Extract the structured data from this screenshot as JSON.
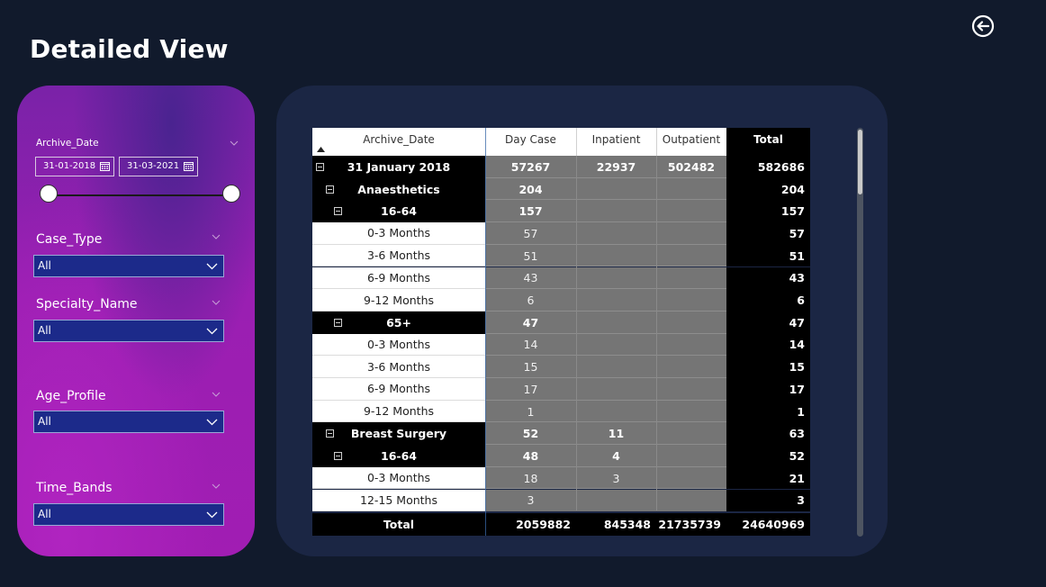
{
  "page": {
    "title": "Detailed View"
  },
  "filters": {
    "archive_date": {
      "label": "Archive_Date",
      "start": "31-01-2018",
      "end": "31-03-2021",
      "range_fraction": [
        0,
        1
      ]
    },
    "case_type": {
      "label": "Case_Type",
      "value": "All"
    },
    "specialty_name": {
      "label": "Specialty_Name",
      "value": "All"
    },
    "age_profile": {
      "label": "Age_Profile",
      "value": "All"
    },
    "time_bands": {
      "label": "Time_Bands",
      "value": "All"
    }
  },
  "matrix": {
    "headers": {
      "archive_date": "Archive_Date",
      "day_case": "Day Case",
      "inpatient": "Inpatient",
      "outpatient": "Outpatient",
      "total": "Total"
    },
    "rows": [
      {
        "kind": "date",
        "label": "31 January 2018",
        "day_case": "57267",
        "inpatient": "22937",
        "outpatient": "502482",
        "total": "582686"
      },
      {
        "kind": "specialty",
        "label": "Anaesthetics",
        "day_case": "204",
        "inpatient": "",
        "outpatient": "",
        "total": "204"
      },
      {
        "kind": "age",
        "label": "16-64",
        "day_case": "157",
        "inpatient": "",
        "outpatient": "",
        "total": "157"
      },
      {
        "kind": "band",
        "label": "0-3 Months",
        "day_case": "57",
        "inpatient": "",
        "outpatient": "",
        "total": "57"
      },
      {
        "kind": "band",
        "label": "3-6 Months",
        "day_case": "51",
        "inpatient": "",
        "outpatient": "",
        "total": "51"
      },
      {
        "kind": "band",
        "label": "6-9 Months",
        "day_case": "43",
        "inpatient": "",
        "outpatient": "",
        "total": "43"
      },
      {
        "kind": "band",
        "label": "9-12 Months",
        "day_case": "6",
        "inpatient": "",
        "outpatient": "",
        "total": "6"
      },
      {
        "kind": "age",
        "label": "65+",
        "day_case": "47",
        "inpatient": "",
        "outpatient": "",
        "total": "47"
      },
      {
        "kind": "band",
        "label": "0-3 Months",
        "day_case": "14",
        "inpatient": "",
        "outpatient": "",
        "total": "14"
      },
      {
        "kind": "band",
        "label": "3-6 Months",
        "day_case": "15",
        "inpatient": "",
        "outpatient": "",
        "total": "15"
      },
      {
        "kind": "band",
        "label": "6-9 Months",
        "day_case": "17",
        "inpatient": "",
        "outpatient": "",
        "total": "17"
      },
      {
        "kind": "band",
        "label": "9-12 Months",
        "day_case": "1",
        "inpatient": "",
        "outpatient": "",
        "total": "1"
      },
      {
        "kind": "specialty",
        "label": "Breast Surgery",
        "day_case": "52",
        "inpatient": "11",
        "outpatient": "",
        "total": "63"
      },
      {
        "kind": "age",
        "label": "16-64",
        "day_case": "48",
        "inpatient": "4",
        "outpatient": "",
        "total": "52"
      },
      {
        "kind": "band",
        "label": "0-3 Months",
        "day_case": "18",
        "inpatient": "3",
        "outpatient": "",
        "total": "21"
      },
      {
        "kind": "band",
        "label": "12-15 Months",
        "day_case": "3",
        "inpatient": "",
        "outpatient": "",
        "total": "3"
      }
    ],
    "totals": {
      "label": "Total",
      "day_case": "2059882",
      "inpatient": "845348",
      "outpatient": "21735739",
      "total": "24640969"
    }
  },
  "colors": {
    "background": "#111a2c",
    "panel": "#1b2644",
    "filter_gradient_start": "#7a22a8",
    "filter_gradient_end": "#a11db3",
    "dropdown_fill": "#1c2a8a",
    "value_cell": "#757575"
  },
  "icons": {
    "back": "circle-arrow-left-icon",
    "calendar": "calendar-icon",
    "chevron": "chevron-down-icon",
    "expander": "minus-square-icon",
    "sort": "sort-ascending-icon"
  }
}
